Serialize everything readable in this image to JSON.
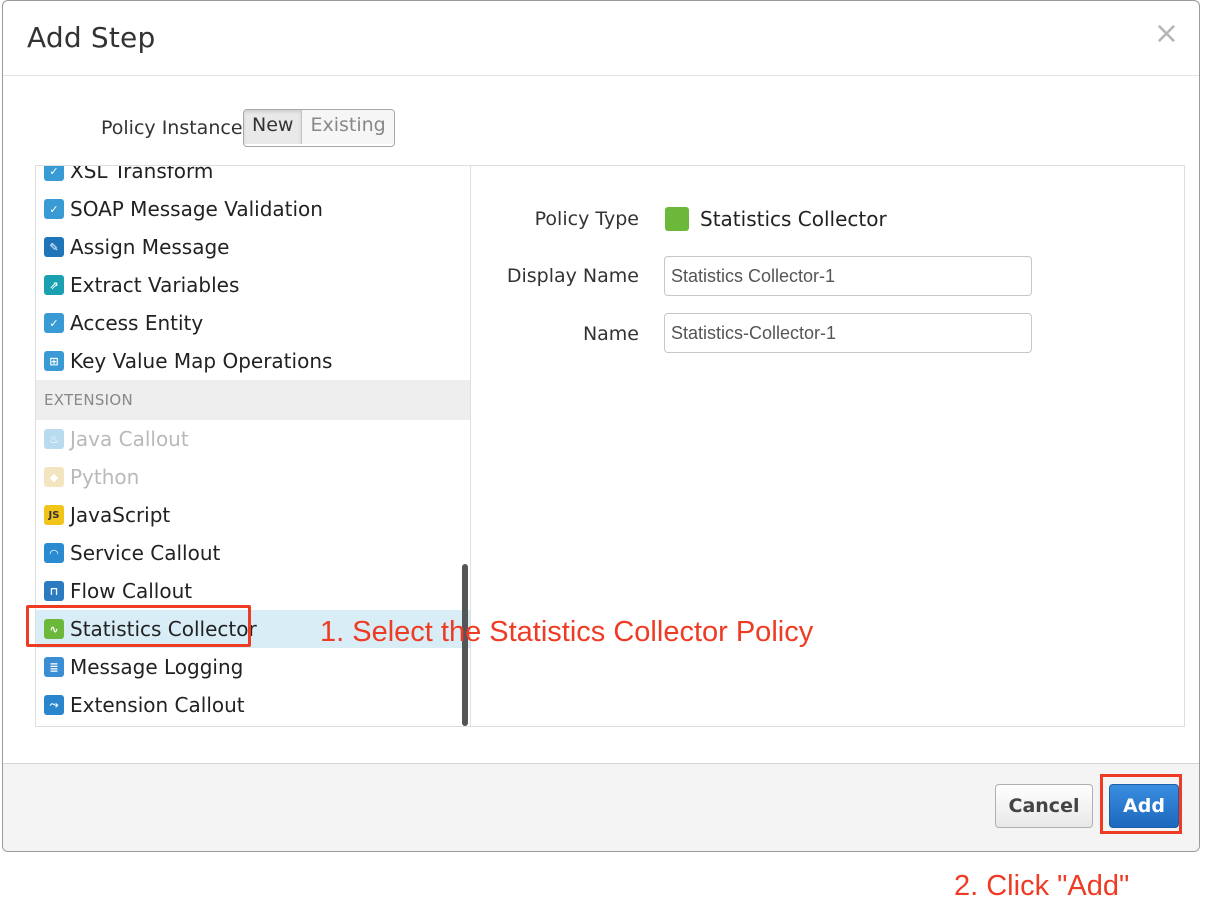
{
  "modal": {
    "title": "Add Step",
    "close_glyph": "×"
  },
  "policy_instance": {
    "label": "Policy Instance",
    "options": [
      "New",
      "Existing"
    ],
    "selected": "New"
  },
  "policy_list": {
    "items_before_section": [
      {
        "label": "XSL Transform",
        "icon": "cloud-check-icon"
      },
      {
        "label": "SOAP Message Validation",
        "icon": "cloud-check-icon"
      },
      {
        "label": "Assign Message",
        "icon": "pencil-icon"
      },
      {
        "label": "Extract Variables",
        "icon": "extract-icon"
      },
      {
        "label": "Access Entity",
        "icon": "cloud-check-icon"
      },
      {
        "label": "Key Value Map Operations",
        "icon": "key-value-map-icon"
      }
    ],
    "section_label": "EXTENSION",
    "items_after_section": [
      {
        "label": "Java Callout",
        "icon": "java-icon",
        "disabled": true
      },
      {
        "label": "Python",
        "icon": "python-icon",
        "disabled": true
      },
      {
        "label": "JavaScript",
        "icon": "javascript-icon",
        "icon_text": "JS"
      },
      {
        "label": "Service Callout",
        "icon": "service-callout-icon"
      },
      {
        "label": "Flow Callout",
        "icon": "flow-callout-icon"
      },
      {
        "label": "Statistics Collector",
        "icon": "statistics-icon",
        "selected": true
      },
      {
        "label": "Message Logging",
        "icon": "message-logging-icon"
      },
      {
        "label": "Extension Callout",
        "icon": "extension-callout-icon"
      }
    ]
  },
  "form": {
    "policy_type_label": "Policy Type",
    "policy_type_value": "Statistics Collector",
    "display_name_label": "Display Name",
    "display_name_value": "Statistics Collector-1",
    "name_label": "Name",
    "name_value": "Statistics-Collector-1"
  },
  "footer": {
    "cancel_label": "Cancel",
    "add_label": "Add"
  },
  "annotations": {
    "step1": "1. Select the Statistics Collector Policy",
    "step2": "2. Click \"Add\"",
    "color": "#ee3b24"
  },
  "colors": {
    "primary_button": "#1d68bd",
    "selected_row": "#d9edf7",
    "stats_icon": "#6bb83a"
  }
}
